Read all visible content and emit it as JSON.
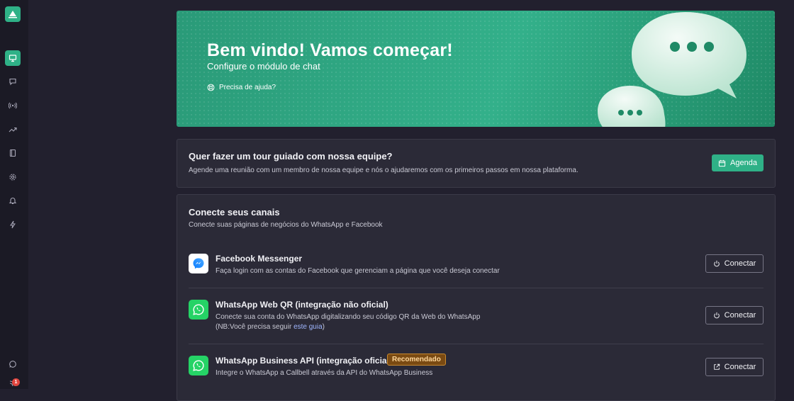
{
  "sidebar": {
    "badge_count": "1"
  },
  "hero": {
    "title": "Bem vindo! Vamos começar!",
    "subtitle": "Configure o módulo de chat",
    "help_label": "Precisa de ajuda?"
  },
  "tour": {
    "title": "Quer fazer um tour guiado com nossa equipe?",
    "description": "Agende uma reunião com um membro de nossa equipe e nós o ajudaremos com os primeiros passos em nossa plataforma.",
    "button_label": "Agenda"
  },
  "channels": {
    "title": "Conecte seus canais",
    "description": "Conecte suas páginas de negócios do WhatsApp e Facebook",
    "items": [
      {
        "name": "Facebook Messenger",
        "description": "Faça login com as contas do Facebook que gerenciam a página que você deseja conectar",
        "button_label": "Conectar"
      },
      {
        "name": "WhatsApp Web QR (integração não oficial)",
        "description": "Conecte sua conta do WhatsApp digitalizando seu código QR da Web do WhatsApp",
        "note_prefix": "(NB:Você precisa seguir ",
        "note_link": "este guia",
        "note_suffix": ")",
        "button_label": "Conectar"
      },
      {
        "name": "WhatsApp Business API (integração oficial)",
        "tag": "Recomendado",
        "description": "Integre o WhatsApp a Callbell através da API do WhatsApp Business",
        "button_label": "Conectar"
      }
    ]
  },
  "colors": {
    "accent": "#2fb187",
    "background": "#22202e",
    "card": "#2b2a37",
    "tag_bg": "#7a4a12"
  }
}
